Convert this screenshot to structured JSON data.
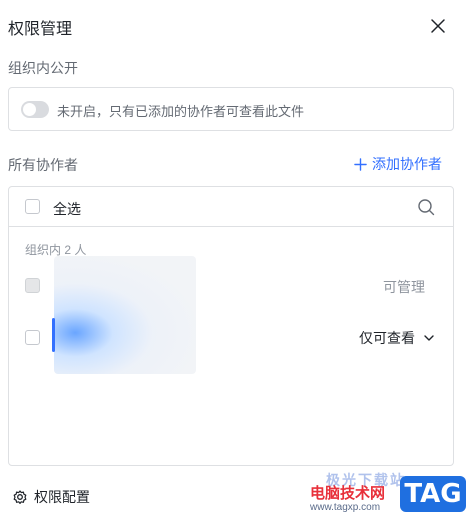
{
  "dialog": {
    "title": "权限管理",
    "close_icon": "close-icon"
  },
  "public_section": {
    "label": "组织内公开",
    "toggle_on": false,
    "description": "未开启，只有已添加的协作者可查看此文件"
  },
  "collaborators": {
    "label": "所有协作者",
    "add_button": "添加协作者",
    "select_all": "全选",
    "group_count": "组织内 2 人",
    "members": [
      {
        "permission": "可管理",
        "editable": false
      },
      {
        "permission": "仅可查看",
        "editable": true
      }
    ]
  },
  "footer": {
    "settings_label": "权限配置"
  },
  "watermark": {
    "top_text": "极光下载站",
    "site": "电脑技术网",
    "url": "www.tagxp.com",
    "tag": "TAG"
  },
  "colors": {
    "accent": "#3370ff",
    "text_primary": "#1f2329",
    "text_secondary": "#646a73",
    "border": "#dee0e3"
  }
}
